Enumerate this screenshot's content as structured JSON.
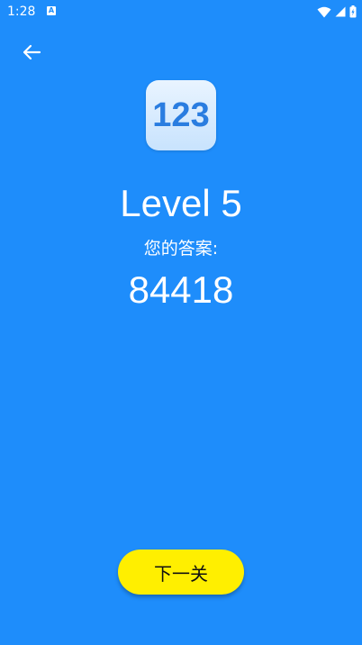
{
  "status_bar": {
    "time": "1:28",
    "notification_badge": "A",
    "icons": [
      "wifi-icon",
      "cellular-signal-icon",
      "battery-icon"
    ]
  },
  "nav": {
    "back_icon": "arrow-left-icon"
  },
  "app_icon": {
    "text": "123"
  },
  "main": {
    "level_title": "Level 5",
    "answer_label": "您的答案:",
    "answer_value": "84418"
  },
  "footer": {
    "next_button_label": "下一关"
  },
  "colors": {
    "background": "#1e8dfb",
    "button": "#ffef00",
    "icon_text": "#2a7de0"
  }
}
